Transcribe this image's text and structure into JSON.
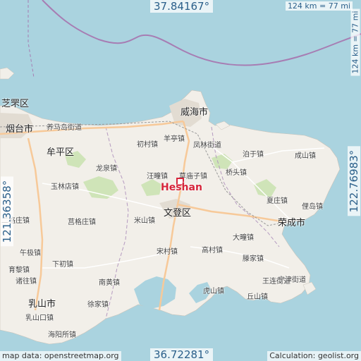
{
  "map": {
    "focus_place": "Heshan",
    "lat_top": "37.84167°",
    "lat_bottom": "36.72281°",
    "lon_left": "121.36358°",
    "lon_right": "122.76983°",
    "scale_h": "124 km = 77 mi",
    "scale_v": "124 km = 77 mi",
    "attribution": "map data: openstreetmap.org",
    "calculation": "Calculation: geolist.org",
    "colors": {
      "water": "#aad3df",
      "land": "#f2efe9",
      "boundary": "#a77db3",
      "focus": "#d6253b"
    }
  },
  "places": [
    {
      "name": "芝罘区",
      "kind": "district"
    },
    {
      "name": "烟台市",
      "kind": "city"
    },
    {
      "name": "养马岛街道",
      "kind": "town"
    },
    {
      "name": "牟平区",
      "kind": "district"
    },
    {
      "name": "威海市",
      "kind": "city"
    },
    {
      "name": "初村镇",
      "kind": "town"
    },
    {
      "name": "羊亭镇",
      "kind": "town"
    },
    {
      "name": "凤林街道",
      "kind": "town"
    },
    {
      "name": "泊于镇",
      "kind": "town"
    },
    {
      "name": "成山镇",
      "kind": "town"
    },
    {
      "name": "龙泉镇",
      "kind": "town"
    },
    {
      "name": "汪疃镇",
      "kind": "town"
    },
    {
      "name": "草庙子镇",
      "kind": "town"
    },
    {
      "name": "桥头镇",
      "kind": "town"
    },
    {
      "name": "玉林店镇",
      "kind": "town"
    },
    {
      "name": "夏庄镇",
      "kind": "town"
    },
    {
      "name": "俚岛镇",
      "kind": "town"
    },
    {
      "name": "文登区",
      "kind": "district"
    },
    {
      "name": "荣成市",
      "kind": "city"
    },
    {
      "name": "二格庄镇",
      "kind": "town"
    },
    {
      "name": "莒格庄镇",
      "kind": "town"
    },
    {
      "name": "米山镇",
      "kind": "town"
    },
    {
      "name": "大疃镇",
      "kind": "town"
    },
    {
      "name": "午极镇",
      "kind": "town"
    },
    {
      "name": "宋村镇",
      "kind": "town"
    },
    {
      "name": "高村镇",
      "kind": "town"
    },
    {
      "name": "滕家镇",
      "kind": "town"
    },
    {
      "name": "育黎镇",
      "kind": "town"
    },
    {
      "name": "下初镇",
      "kind": "town"
    },
    {
      "name": "诸往镇",
      "kind": "town"
    },
    {
      "name": "南黄镇",
      "kind": "town"
    },
    {
      "name": "王连街道",
      "kind": "town"
    },
    {
      "name": "宁津街道",
      "kind": "town"
    },
    {
      "name": "虎山镇",
      "kind": "town"
    },
    {
      "name": "乳山市",
      "kind": "city"
    },
    {
      "name": "徐家镇",
      "kind": "town"
    },
    {
      "name": "丘山镇",
      "kind": "town"
    },
    {
      "name": "乳山口镇",
      "kind": "town"
    },
    {
      "name": "海阳所镇",
      "kind": "town"
    }
  ]
}
